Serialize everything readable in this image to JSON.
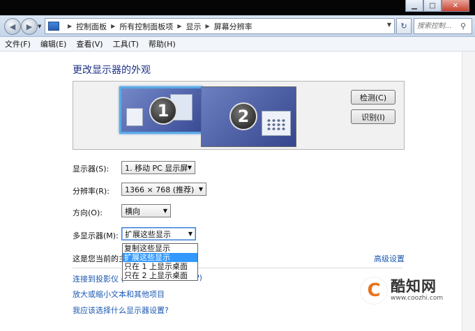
{
  "address": {
    "crumbs": [
      "控制面板",
      "所有控制面板项",
      "显示",
      "屏幕分辨率"
    ],
    "search_placeholder": "搜索控制..."
  },
  "menu": [
    "文件(F)",
    "编辑(E)",
    "查看(V)",
    "工具(T)",
    "帮助(H)"
  ],
  "page": {
    "heading": "更改显示器的外观",
    "monitor1_number": "1",
    "monitor2_number": "2",
    "detect_button": "检测(C)",
    "identify_button": "识别(I)"
  },
  "form": {
    "display_label": "显示器(S):",
    "display_value": "1. 移动 PC 显示屏",
    "resolution_label": "分辨率(R):",
    "resolution_value": "1366 × 768 (推荐)",
    "orientation_label": "方向(O):",
    "orientation_value": "横向",
    "multi_label": "多显示器(M):",
    "multi_value": "扩展这些显示",
    "multi_options": [
      "复制这些显示",
      "扩展这些显示",
      "只在 1 上显示桌面",
      "只在 2 上显示桌面"
    ],
    "selected_index": 1
  },
  "text": {
    "current_primary_partial": "这是您当前的主",
    "advanced_link": "高级设置",
    "projector_link_partial": "连接到投影仪 (",
    "projector_link_tail": "P)",
    "text_size_link": "放大或缩小文本和其他项目",
    "which_settings_link": "我应该选择什么显示器设置?"
  },
  "watermark": {
    "title": "酷知网",
    "url": "www.coozhi.com"
  }
}
